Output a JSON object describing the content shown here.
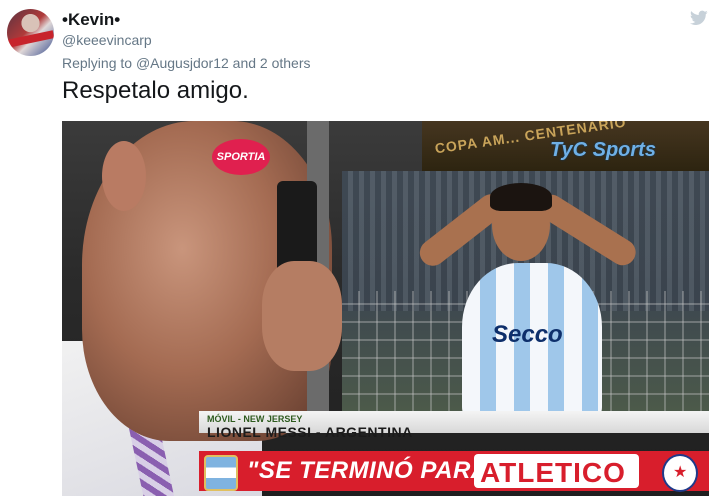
{
  "tweet": {
    "display_name": "•Kevin•",
    "handle": "@keeevincarp",
    "reply_prefix": "Replying to",
    "reply_user": "@Augusjdor12",
    "reply_suffix": "and 2 others",
    "text": "Respetalo amigo."
  },
  "media": {
    "channel_logo_text": "TyC Sports",
    "banner_text": "COPA AM... CENTENARIO",
    "sportia_text": "SPORTIA",
    "jersey_text": "Secco",
    "lower_third_small": "MÓVIL - NEW JERSEY",
    "lower_third_name": "LIONEL MESSI - ARGENTINA",
    "ticker_quote": "\"SE TERMINÓ PARA MÍ",
    "ticker_highlight": "ATLETICO"
  },
  "icons": {
    "platform": "twitter-bird-icon"
  },
  "colors": {
    "twitter_gray": "#657786",
    "ticker_red": "#d81e2c"
  }
}
